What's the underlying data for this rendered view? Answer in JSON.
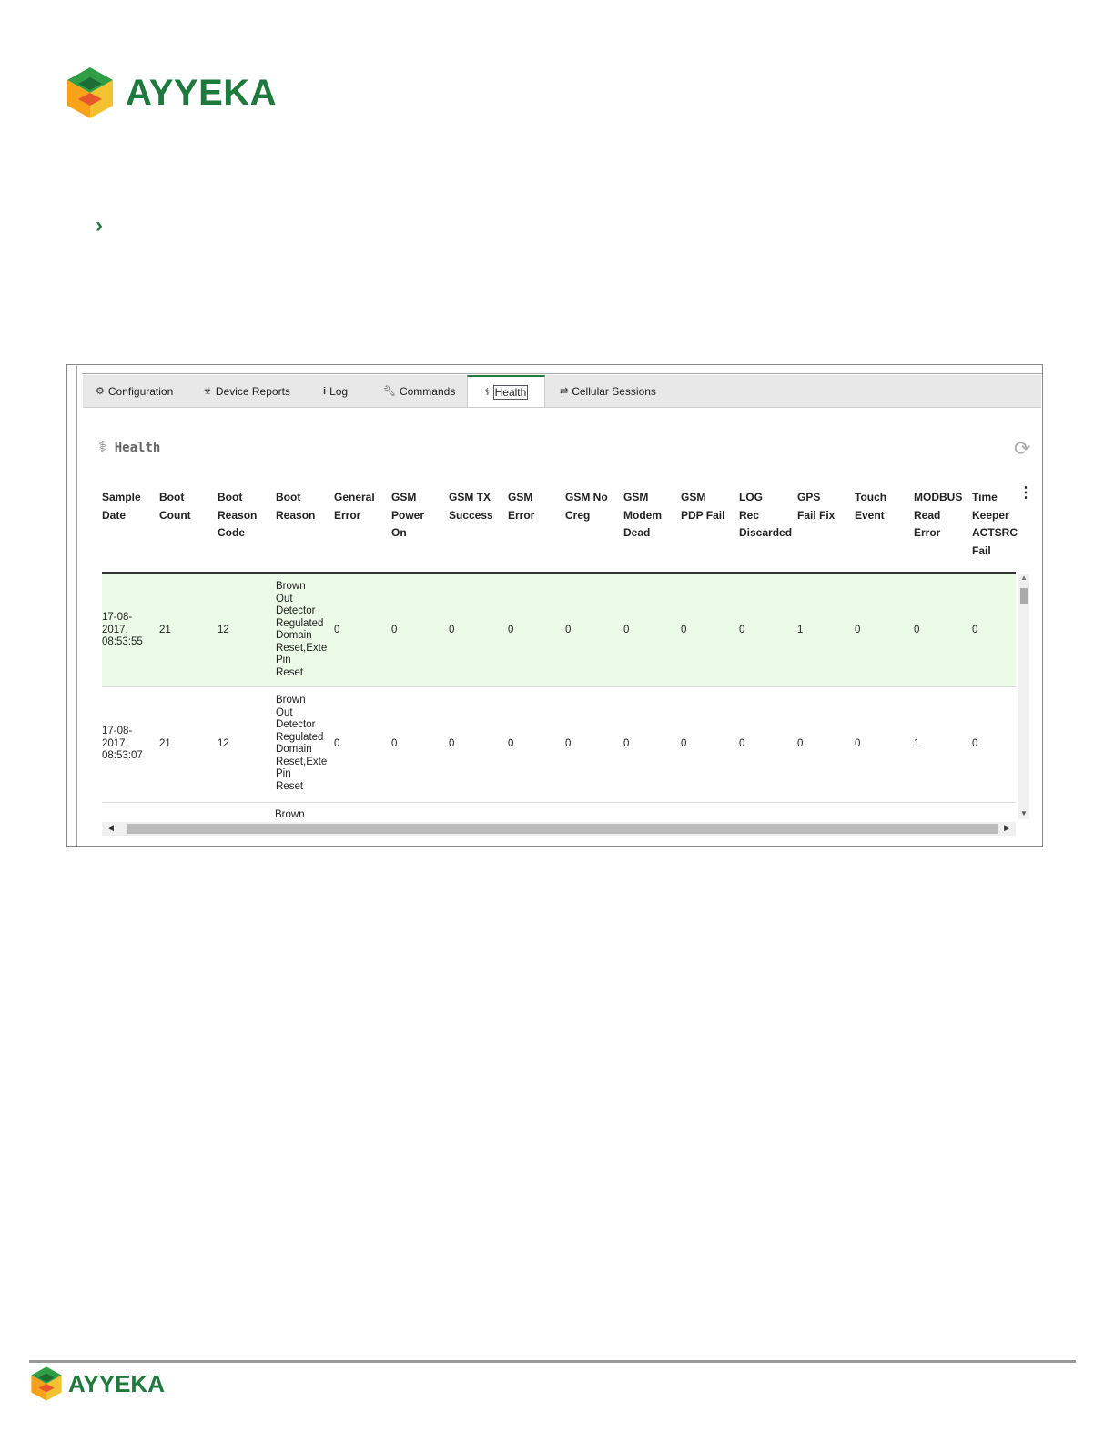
{
  "brand": {
    "name": "AYYEKA",
    "color": "#1e7a3c"
  },
  "bullet": "›",
  "tabs": [
    {
      "icon": "gears-icon",
      "label": "Configuration"
    },
    {
      "icon": "biohazard-icon",
      "label": "Device Reports"
    },
    {
      "icon": "info-icon",
      "label": "Log"
    },
    {
      "icon": "wrench-icon",
      "label": "Commands"
    },
    {
      "icon": "stethoscope-icon",
      "label": "Health"
    },
    {
      "icon": "exchange-icon",
      "label": "Cellular Sessions"
    }
  ],
  "panel": {
    "title": "Health"
  },
  "columns": [
    [
      "Sample",
      "Date"
    ],
    [
      "Boot",
      "Count"
    ],
    [
      "Boot",
      "Reason",
      "Code"
    ],
    [
      "Boot",
      "Reason"
    ],
    [
      "General",
      "Error"
    ],
    [
      "GSM",
      "Power",
      "On"
    ],
    [
      "GSM TX",
      "Success"
    ],
    [
      "GSM",
      "Error"
    ],
    [
      "GSM No",
      "Creg"
    ],
    [
      "GSM",
      "Modem",
      "Dead"
    ],
    [
      "GSM",
      "PDP Fail"
    ],
    [
      "LOG",
      "Rec",
      "Discarded"
    ],
    [
      "GPS",
      "Fail Fix"
    ],
    [
      "Touch",
      "Event"
    ],
    [
      "MODBUS",
      "Read",
      "Error"
    ],
    [
      "Time",
      "Keeper",
      "ACTSRC",
      "Fail"
    ]
  ],
  "rows": [
    {
      "date": [
        "17-08-",
        "2017,",
        "08:53:55"
      ],
      "boot_count": "21",
      "reason_code": "12",
      "reason": [
        "Brown",
        "Out",
        "Detector",
        "Regulated",
        "Domain",
        "Reset,Exte",
        "Pin",
        "Reset"
      ],
      "values": [
        "0",
        "0",
        "0",
        "0",
        "0",
        "0",
        "0",
        "0",
        "1",
        "0",
        "0",
        "0"
      ]
    },
    {
      "date": [
        "17-08-",
        "2017,",
        "08:53:07"
      ],
      "boot_count": "21",
      "reason_code": "12",
      "reason": [
        "Brown",
        "Out",
        "Detector",
        "Regulated",
        "Domain",
        "Reset,Exte",
        "Pin",
        "Reset"
      ],
      "values": [
        "0",
        "0",
        "0",
        "0",
        "0",
        "0",
        "0",
        "0",
        "0",
        "0",
        "1",
        "0"
      ]
    }
  ],
  "row3_partial": "Brown"
}
